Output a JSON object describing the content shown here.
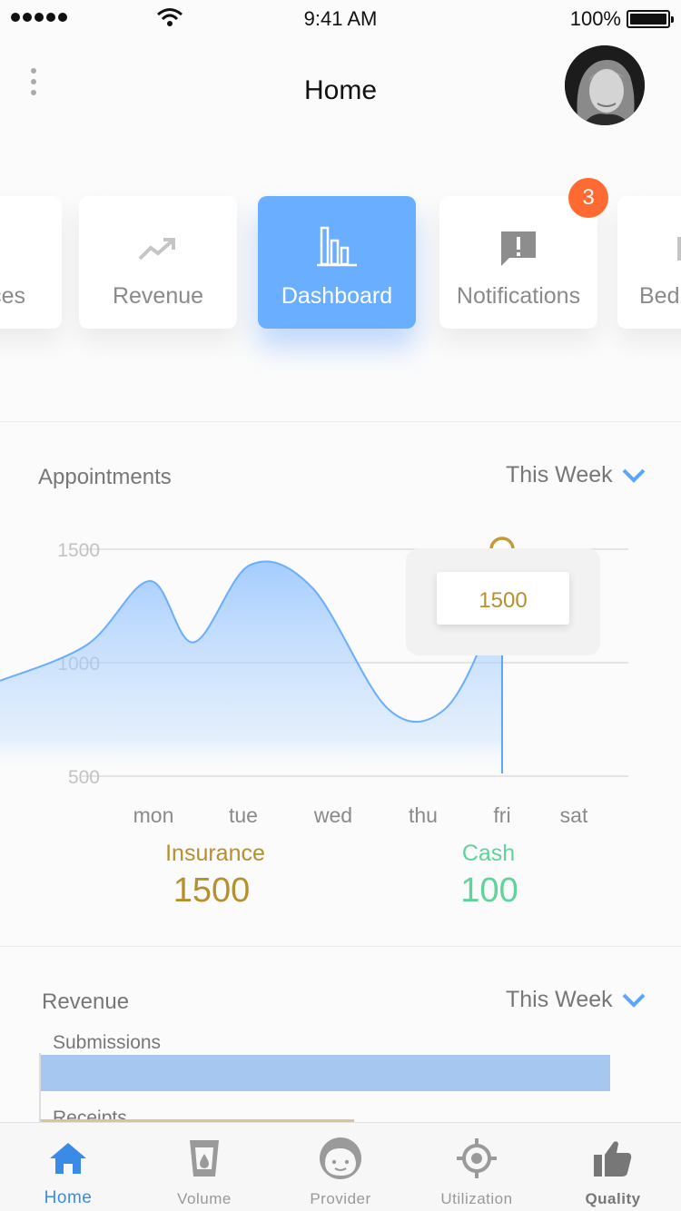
{
  "status_bar": {
    "time": "9:41 AM",
    "battery": "100%"
  },
  "header": {
    "title": "Home"
  },
  "tiles": [
    {
      "label": "ces",
      "icon": "services-icon"
    },
    {
      "label": "Revenue",
      "icon": "trend-up-icon"
    },
    {
      "label": "Dashboard",
      "icon": "bar-chart-icon",
      "active": true
    },
    {
      "label": "Notifications",
      "icon": "alert-message-icon",
      "badge": "3"
    },
    {
      "label": "Bed",
      "icon": "bed-icon"
    }
  ],
  "appointments": {
    "title": "Appointments",
    "range": "This Week",
    "tooltip": "1500",
    "insurance_label": "Insurance",
    "insurance_value": "1500",
    "cash_label": "Cash",
    "cash_value": "100"
  },
  "chart_data": {
    "type": "area",
    "title": "Appointments",
    "categories": [
      "mon",
      "tue",
      "wed",
      "thu",
      "fri",
      "sat"
    ],
    "y_ticks": [
      "1500",
      "1000",
      "500"
    ],
    "ylim": [
      500,
      1500
    ],
    "series": [
      {
        "x": [
          0.0,
          0.7,
          1.2,
          1.55,
          2.0,
          2.5,
          3.1,
          3.55,
          3.9,
          4.02
        ],
        "y": [
          920,
          1080,
          1360,
          1090,
          1430,
          1330,
          800,
          790,
          1150,
          1500
        ]
      }
    ],
    "highlight": {
      "x": "fri",
      "y": 1500
    },
    "grid": true,
    "colors": {
      "line": "#6aaeff",
      "fill_top": "#8fc1ff",
      "marker": "#c49a3a"
    }
  },
  "revenue": {
    "title": "Revenue",
    "range": "This Week",
    "bars": [
      {
        "label": "Submissions",
        "value": 1.0
      },
      {
        "label": "Receipts",
        "value": 0.55
      }
    ]
  },
  "tabbar": {
    "items": [
      {
        "label": "Home",
        "icon": "home-icon",
        "active": true
      },
      {
        "label": "Volume",
        "icon": "cup-icon"
      },
      {
        "label": "Provider",
        "icon": "face-icon"
      },
      {
        "label": "Utilization",
        "icon": "target-icon"
      },
      {
        "label": "Quality",
        "icon": "thumbs-up-icon"
      }
    ]
  },
  "colors": {
    "accent": "#6aaeff",
    "insurance": "#b5902e",
    "cash": "#5fd39a",
    "badge": "#ff6a33",
    "tab_active": "#3a8ae8"
  }
}
